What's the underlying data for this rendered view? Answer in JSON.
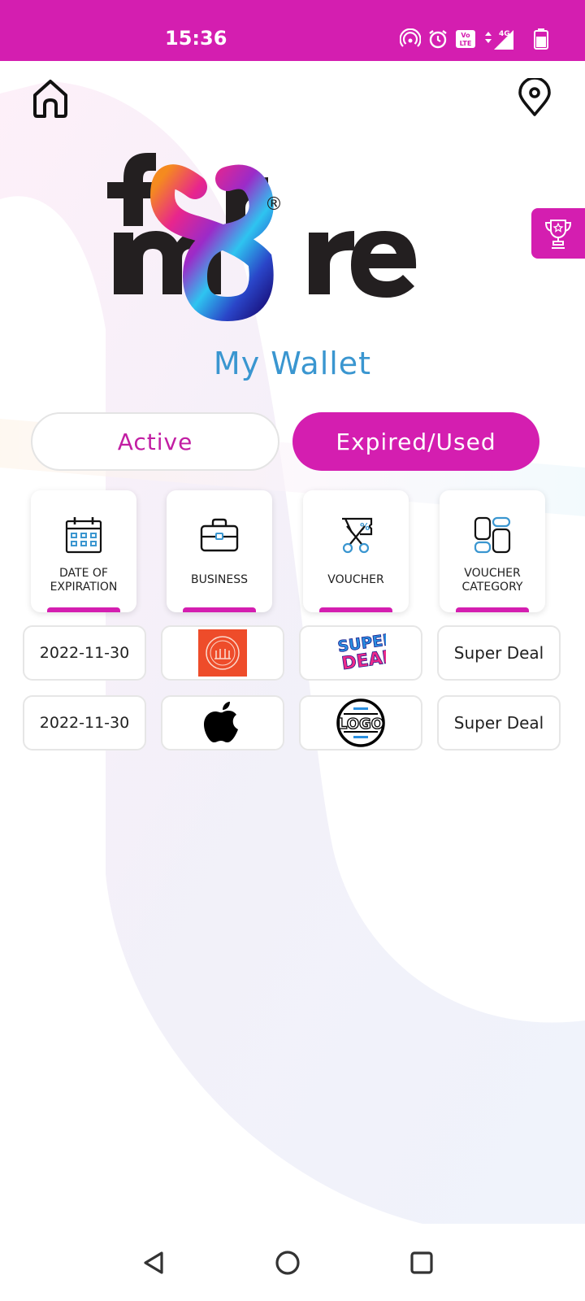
{
  "status_bar": {
    "time": "15:36",
    "network": "4G",
    "icons": [
      "hotspot-icon",
      "alarm-icon",
      "volte-icon",
      "signal-icon",
      "battery-icon"
    ]
  },
  "header": {
    "home_icon": "home-icon",
    "location_icon": "location-pin-icon",
    "trophy_icon": "trophy-icon",
    "logo_text_line1": "for",
    "logo_text_line2": "more",
    "logo_mark": "®"
  },
  "page_title": "My Wallet",
  "tabs": {
    "active": "Active",
    "expired": "Expired/Used",
    "selected": "expired"
  },
  "categories": [
    {
      "label_line1": "DATE OF",
      "label_line2": "EXPIRATION",
      "icon": "calendar-icon"
    },
    {
      "label_line1": "BUSINESS",
      "label_line2": "",
      "icon": "briefcase-icon"
    },
    {
      "label_line1": "VOUCHER",
      "label_line2": "",
      "icon": "voucher-scissors-icon"
    },
    {
      "label_line1": "VOUCHER",
      "label_line2": "CATEGORY",
      "icon": "category-grid-icon"
    }
  ],
  "vouchers": [
    {
      "date": "2022-11-30",
      "business_logo": "business-logo-red-icon",
      "voucher_logo": "super-deal-logo",
      "voucher_text_1": "SUPER",
      "voucher_text_2": "DEAL",
      "category": "Super Deal"
    },
    {
      "date": "2022-11-30",
      "business_logo": "apple-logo-icon",
      "voucher_logo": "generic-logo",
      "voucher_text_1": "LOGO",
      "category": "Super Deal"
    }
  ],
  "colors": {
    "brand": "#d41eb0",
    "title_blue": "#3a96d0"
  },
  "nav": {
    "back_icon": "back-triangle-icon",
    "home_icon": "home-circle-icon",
    "recents_icon": "recents-square-icon"
  }
}
